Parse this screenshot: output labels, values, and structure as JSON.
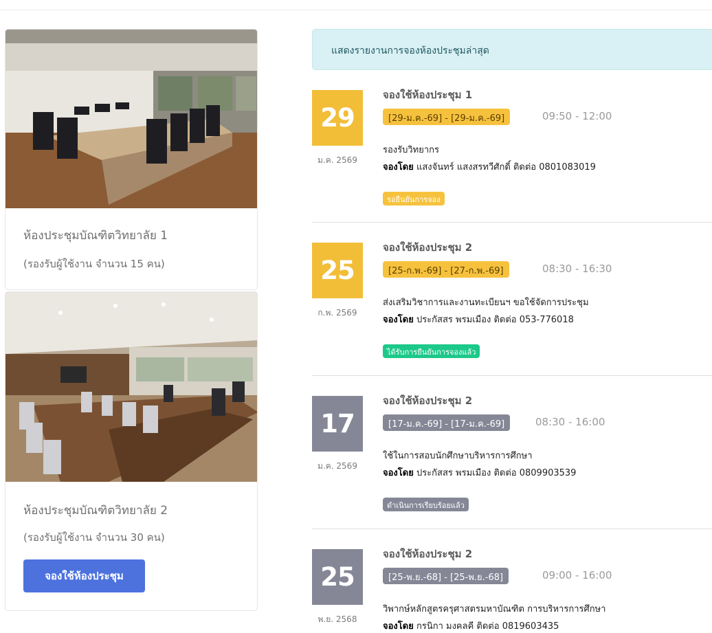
{
  "colors": {
    "pending_date": "#f2be38",
    "done_date": "#858796",
    "pending_badge": "#f6c23e",
    "confirmed_badge": "#1cc88a",
    "completed_badge": "#858796",
    "button": "#4d72de"
  },
  "rooms": [
    {
      "name": "ห้องประชุมบัณฑิตวิทยาลัย 1",
      "capacity": "(รองรับผู้ใช้งาน จำนวน 15 คน)"
    },
    {
      "name": "ห้องประชุมบัณฑิตวิทยาลัย 2",
      "capacity": "(รองรับผู้ใช้งาน จำนวน 30 คน)",
      "book_label": "จองใช้ห้องประชุม"
    }
  ],
  "list_header": "แสดงรายงานการจองห้องประชุมล่าสุด",
  "by_label": "จองโดย",
  "bookings": [
    {
      "day": "29",
      "month": "ม.ค. 2569",
      "title": "จองใช้ห้องประชุม 1",
      "range": "[29-ม.ค.-69] - [29-ม.ค.-69]",
      "time": "09:50 - 12:00",
      "purpose": "รองรับวิทยากร",
      "by": "แสงจันทร์ แสงสรทวีศักดิ์ ติดต่อ 0801083019",
      "status": "รอยืนยันการจอง"
    },
    {
      "day": "25",
      "month": "ก.พ. 2569",
      "title": "จองใช้ห้องประชุม 2",
      "range": "[25-ก.พ.-69] - [27-ก.พ.-69]",
      "time": "08:30 - 16:30",
      "purpose": "ส่งเสริมวิชาการและงานทะเบียนฯ ขอใช้จัดการประชุม",
      "by": "ประกัสสร พรมเมือง ติดต่อ 053-776018",
      "status": "ได้รับการยืนยันการจองแล้ว"
    },
    {
      "day": "17",
      "month": "ม.ค. 2569",
      "title": "จองใช้ห้องประชุม 2",
      "range": "[17-ม.ค.-69] - [17-ม.ค.-69]",
      "time": "08:30 - 16:00",
      "purpose": "ใช้ในการสอบนักศึกษาบริหารการศึกษา",
      "by": "ประกัสสร พรมเมือง ติดต่อ 0809903539",
      "status": "ดำเนินการเรียบร้อยแล้ว"
    },
    {
      "day": "25",
      "month": "พ.ย. 2568",
      "title": "จองใช้ห้องประชุม 2",
      "range": "[25-พ.ย.-68] - [25-พ.ย.-68]",
      "time": "09:00 - 16:00",
      "purpose": "วิพากษ์หลักสูตรครุศาสตรมหาบัณฑิต การบริหารการศึกษา",
      "by": "กรนิกา มงคลคี ติดต่อ 0819603435"
    }
  ]
}
